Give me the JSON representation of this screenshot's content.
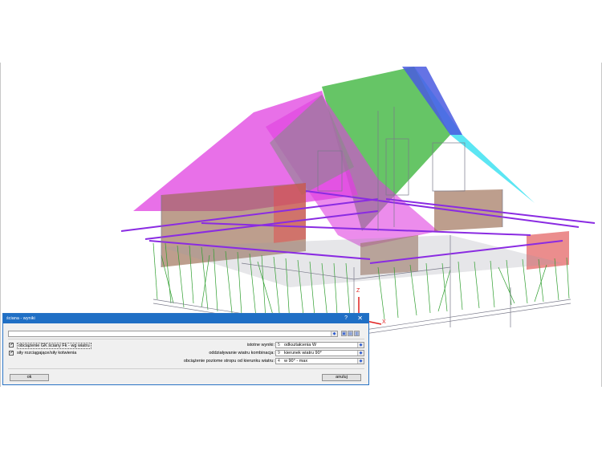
{
  "dialog": {
    "title": "ściana - wyniki",
    "help_glyph": "?",
    "close_glyph": "✕",
    "top_combo_value": "",
    "checkboxes": [
      {
        "label": "obciążenie GK ściany Fk - wg wiatru",
        "checked": true
      },
      {
        "label": "siły rozciągające/siły kotwienia",
        "checked": true
      }
    ],
    "fields": [
      {
        "label": "istotne wyniki:",
        "number": "5",
        "value": "odkształcenia W"
      },
      {
        "label": "oddziaływanie wiatru kombinacja:",
        "number": "9",
        "value": "kierunek wiatru 90°"
      },
      {
        "label": "obciążenie poziome stropu od kierunku wiatru:",
        "number": "4",
        "value": "w 90° - max"
      }
    ],
    "ok_label": "ok",
    "cancel_label": "anuluj"
  },
  "model": {
    "axis_z_label": "Z",
    "axis_x_label": "X",
    "colors": {
      "magenta_roof": "#e040e0",
      "green_roof": "#33b233",
      "cyan_roof": "#33e0f0",
      "blue_roof": "#4a5ae0",
      "brown_wall": "#9a6a50",
      "red_wall": "#e05050",
      "beam_purple": "#8a2be2",
      "stud_green": "#2e9e2e",
      "frame_gray": "#7a7a8a"
    }
  }
}
